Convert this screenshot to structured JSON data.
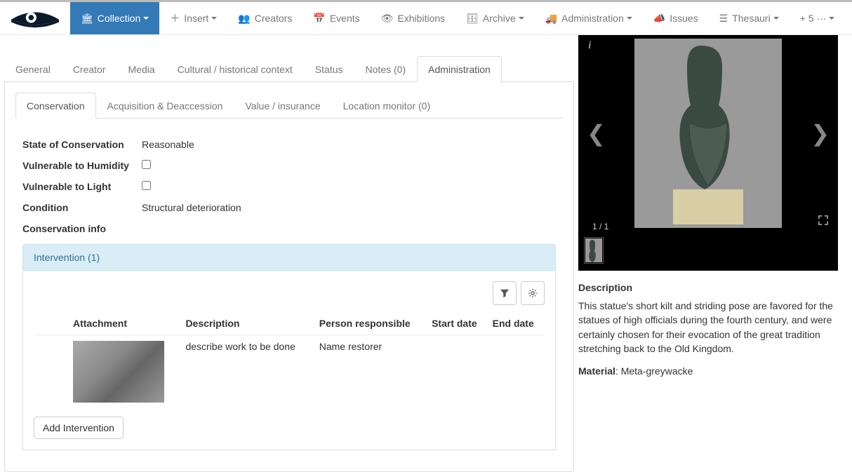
{
  "nav": {
    "collection": "Collection",
    "insert": "Insert",
    "creators": "Creators",
    "events": "Events",
    "exhibitions": "Exhibitions",
    "archive": "Archive",
    "administration": "Administration",
    "issues": "Issues",
    "thesauri": "Thesauri",
    "more": "+ 5 ···"
  },
  "main_tabs": {
    "general": "General",
    "creator": "Creator",
    "media": "Media",
    "context": "Cultural / historical context",
    "status": "Status",
    "notes": "Notes (0)",
    "administration": "Administration"
  },
  "sub_tabs": {
    "conservation": "Conservation",
    "acquisition": "Acquisition & Deaccession",
    "value": "Value / insurance",
    "location": "Location monitor (0)"
  },
  "fields": {
    "state_label": "State of Conservation",
    "state_value": "Reasonable",
    "humidity_label": "Vulnerable to Humidity",
    "humidity_checked": false,
    "light_label": "Vulnerable to Light",
    "light_checked": false,
    "condition_label": "Condition",
    "condition_value": "Structural deterioration",
    "info_label": "Conservation info"
  },
  "intervention": {
    "header": "Intervention (1)",
    "columns": {
      "attachment": "Attachment",
      "description": "Description",
      "person": "Person responsible",
      "start_date": "Start date",
      "end_date": "End date"
    },
    "rows": [
      {
        "description": "describe work to be done",
        "person": "Name restorer",
        "start_date": "",
        "end_date": ""
      }
    ],
    "add_button": "Add Intervention"
  },
  "image_viewer": {
    "page_indicator": "1 / 1"
  },
  "description": {
    "title": "Description",
    "body": "This statue's short kilt and striding pose are favored for the statues of high officials during the fourth century, and were certainly chosen for their evocation of the great tradition stretching back to the Old Kingdom.",
    "material_label": "Material",
    "material_value": ": Meta-greywacke"
  }
}
